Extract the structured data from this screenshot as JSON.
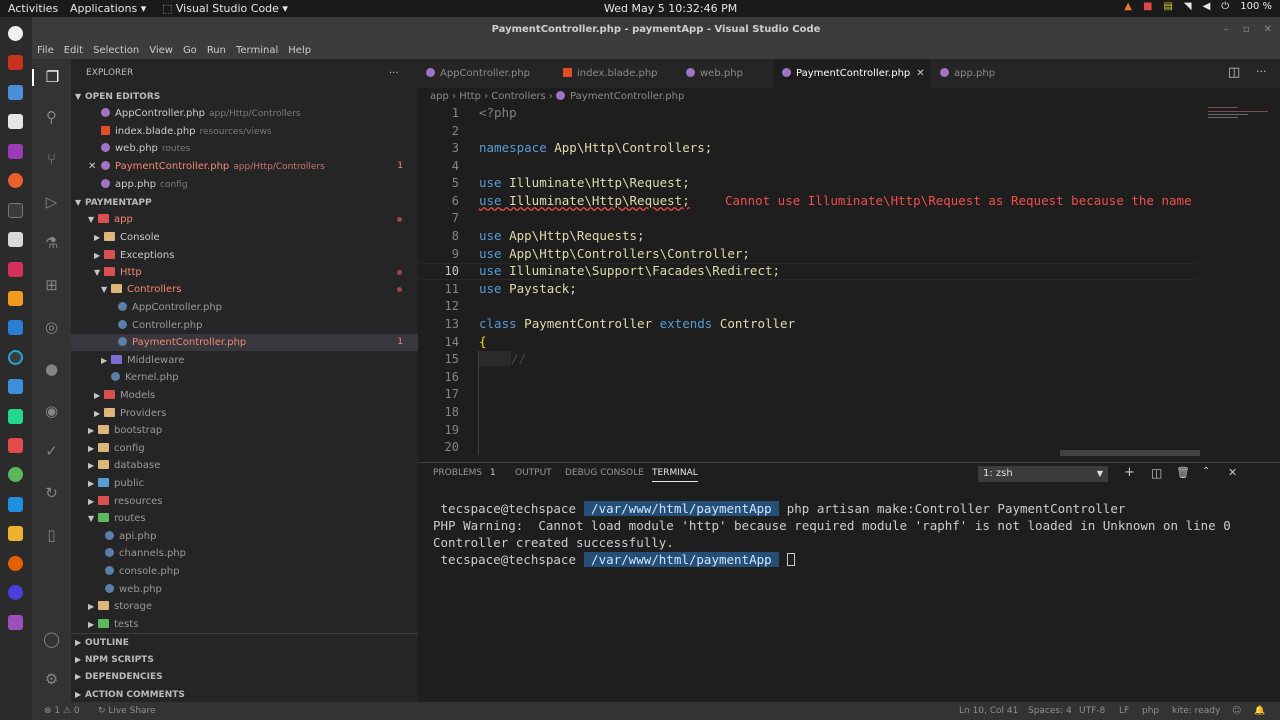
{
  "topbar": {
    "activities": "Activities",
    "applications": "Applications ▾",
    "app_name": "Visual Studio Code ▾",
    "clock": "Wed May 5  10:32:46 PM",
    "battery": "100 %"
  },
  "window": {
    "title": "PaymentController.php - paymentApp - Visual Studio Code"
  },
  "menubar": [
    "File",
    "Edit",
    "Selection",
    "View",
    "Go",
    "Run",
    "Terminal",
    "Help"
  ],
  "sidebar": {
    "title": "EXPLORER",
    "open_editors_header": "OPEN EDITORS",
    "open_editors": [
      {
        "name": "AppController.php",
        "desc": "app/Http/Controllers",
        "badge": ""
      },
      {
        "name": "index.blade.php",
        "desc": "resources/views",
        "badge": ""
      },
      {
        "name": "web.php",
        "desc": "routes",
        "badge": ""
      },
      {
        "name": "PaymentController.php",
        "desc": "app/Http/Controllers",
        "badge": "1"
      },
      {
        "name": "app.php",
        "desc": "config",
        "badge": ""
      }
    ],
    "project_header": "PAYMENTAPP",
    "tree": [
      {
        "label": "app"
      },
      {
        "label": "Console"
      },
      {
        "label": "Exceptions"
      },
      {
        "label": "Http"
      },
      {
        "label": "Controllers"
      },
      {
        "label": "AppController.php"
      },
      {
        "label": "Controller.php"
      },
      {
        "label": "PaymentController.php",
        "badge": "1"
      },
      {
        "label": "Middleware"
      },
      {
        "label": "Kernel.php"
      },
      {
        "label": "Models"
      },
      {
        "label": "Providers"
      },
      {
        "label": "bootstrap"
      },
      {
        "label": "config"
      },
      {
        "label": "database"
      },
      {
        "label": "public"
      },
      {
        "label": "resources"
      },
      {
        "label": "routes"
      },
      {
        "label": "api.php"
      },
      {
        "label": "channels.php"
      },
      {
        "label": "console.php"
      },
      {
        "label": "web.php"
      },
      {
        "label": "storage"
      },
      {
        "label": "tests"
      }
    ],
    "outline": "OUTLINE",
    "npm_scripts": "NPM SCRIPTS",
    "dependencies": "DEPENDENCIES",
    "action_comments": "ACTION COMMENTS"
  },
  "tabs": [
    {
      "label": "AppController.php"
    },
    {
      "label": "index.blade.php"
    },
    {
      "label": "web.php"
    },
    {
      "label": "PaymentController.php",
      "active": true
    },
    {
      "label": "app.php"
    }
  ],
  "breadcrumbs": [
    "app",
    "Http",
    "Controllers",
    "PaymentController.php"
  ],
  "editor": {
    "line_numbers": [
      "1",
      "2",
      "3",
      "4",
      "5",
      "6",
      "7",
      "8",
      "9",
      "10",
      "11",
      "12",
      "13",
      "14",
      "15",
      "16",
      "17",
      "18",
      "19",
      "20"
    ],
    "lines": {
      "l1": "<?php",
      "l3_kw": "namespace",
      "l3_rest": " App\\Http\\Controllers;",
      "l5_kw": "use",
      "l5_rest": " Illuminate\\Http\\Request;",
      "l6_kw": "use",
      "l6_rest": " Illuminate\\Http\\Request;",
      "l6_error": "Cannot use Illuminate\\Http\\Request as Request because the name",
      "l8_kw": "use",
      "l8_rest": " App\\Http\\Requests;",
      "l9_kw": "use",
      "l9_rest": " App\\Http\\Controllers\\Controller;",
      "l10_kw": "use",
      "l10_rest": " Illuminate\\Support\\Facades\\Redirect;",
      "l11_kw": "use",
      "l11_rest": " Paystack;",
      "l13_kw": "class",
      "l13_cls": " PaymentController",
      "l13_kw2": " extends",
      "l13_cls2": " Controller",
      "l14": "{",
      "l15": "//"
    }
  },
  "panel": {
    "tabs": [
      "PROBLEMS",
      "OUTPUT",
      "DEBUG CONSOLE",
      "TERMINAL"
    ],
    "problems_count": "1",
    "terminal_select": "1: zsh",
    "terminal_lines": {
      "p1_user": " tecspace@techspace ",
      "p1_path": " /var/www/html/paymentApp ",
      "p1_cmd": " php artisan make:Controller PaymentController",
      "out1": "PHP Warning:  Cannot load module 'http' because required module 'raphf' is not loaded in Unknown on line 0",
      "out2": "Controller created successfully.",
      "p2_user": " tecspace@techspace ",
      "p2_path": " /var/www/html/paymentApp "
    }
  },
  "statusbar": {
    "problems": "⊗ 1 ⚠ 0",
    "live_share": "Live Share",
    "position": "Ln 10, Col 41",
    "spaces": "Spaces: 4",
    "encoding": "UTF-8",
    "eol": "LF",
    "language": "php",
    "kite": "kite: ready"
  },
  "colors": {
    "accent": "#007acc",
    "error": "#f48771",
    "folder": "#dcb67a",
    "php_file": "#a074c4"
  }
}
